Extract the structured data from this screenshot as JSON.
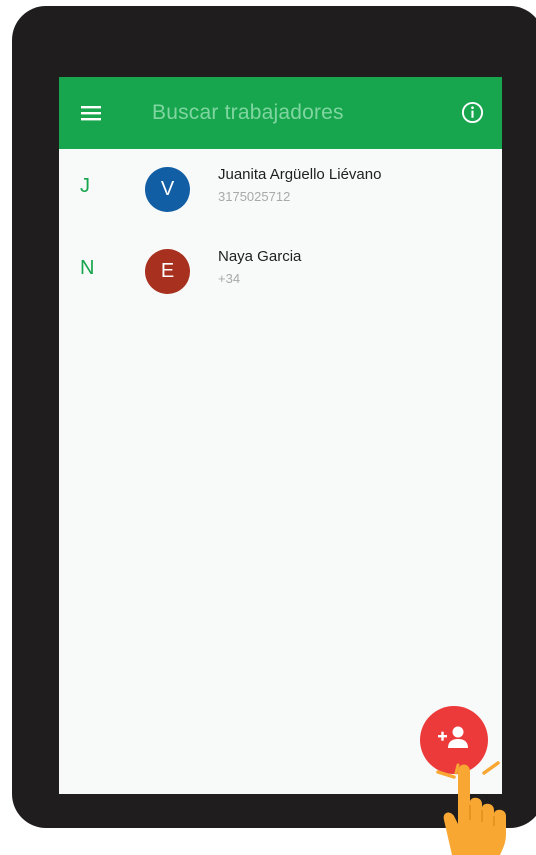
{
  "appbar": {
    "title": "Buscar trabajadores",
    "menu_icon": "hamburger-menu-icon",
    "info_icon": "info-icon",
    "color": "#17a54d"
  },
  "contacts": [
    {
      "section_letter": "J",
      "avatar_letter": "V",
      "avatar_color": "#125ea4",
      "name": "Juanita Argüello Liévano",
      "phone": "3175025712"
    },
    {
      "section_letter": "N",
      "avatar_letter": "E",
      "avatar_color": "#a8301f",
      "name": "Naya Garcia",
      "phone": "+34"
    }
  ],
  "fab": {
    "icon": "add-person-icon",
    "color": "#ec3a3a"
  },
  "overlay": {
    "pointer_icon": "tap-hand-icon",
    "color": "#f7a732"
  }
}
